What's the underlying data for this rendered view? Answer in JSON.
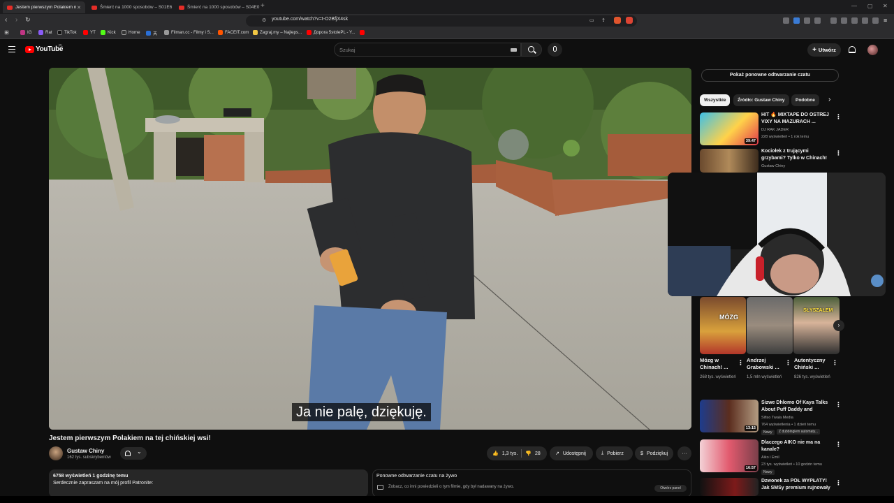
{
  "browser": {
    "tabs": [
      {
        "label": "Jestem pierwszym Polakiem n"
      },
      {
        "label": "Śmierć na 1000 sposobów – S01E6"
      },
      {
        "label": "Śmierć na 1000 sposobów – S04E0"
      }
    ],
    "new_tab": "+",
    "url": "youtube.com/watch?v=t-O2BfjX4sk",
    "bookmarks": [
      "IG",
      "Rat",
      "TikTok",
      "YT",
      "Kick",
      "Home",
      "天",
      "Filman.cc - Filmy i S...",
      "FACEIT.com",
      "Zagraj.my – Najleps...",
      "Доpora 5stolePL - Y..."
    ]
  },
  "header": {
    "logo": "YouTube",
    "region": "PL",
    "search_placeholder": "Szukaj",
    "create_label": "Utwórz"
  },
  "video": {
    "subtitle": "Ja nie palę, dziękuję.",
    "title": "Jestem pierwszym Polakiem na tej chińskiej wsi!",
    "channel": "Gustaw Chiny",
    "subscribers": "162 tys. subskrybentów",
    "likes": "1,3 tys.",
    "dislikes": "28",
    "share": "Udostępnij",
    "download": "Pobierz",
    "thanks": "Podziękuj",
    "desc_meta": "6758 wyświetleń  1 godzinę temu",
    "desc_text": "Serdecznie zapraszam na mój profil Patronite:",
    "chat_title": "Ponowne odtwarzanie czatu na żywo",
    "chat_sub": "Zobacz, co inni powiedzieli o tym filmie, gdy był nadawany na żywo.",
    "chat_button": "Otwórz panel"
  },
  "sidebar": {
    "replay_button": "Pokaż ponowne odtwarzanie czatu",
    "chips": [
      "Wszystkie",
      "Źródło: Gustaw Chiny",
      "Podobne"
    ],
    "recommendations_top": [
      {
        "title": "HIT 🔥 MIXTAPE DO OSTREJ VIXY NA MAZURACH ...",
        "channel": "DJ RAK JADER",
        "meta": "228 wyświetleń • 1 rok temu",
        "duration": "39:47"
      },
      {
        "title": "Kociołek z trującymi grzybami? Tylko w Chinach!",
        "channel": "Gustaw Chiny",
        "meta": ""
      }
    ],
    "shorts": [
      {
        "title": "Mózg w Chinach! ...",
        "views": "268 tys. wyświetleń",
        "overlay": "MÓZG"
      },
      {
        "title": "Andrzej Grabowski ...",
        "views": "1,5 mln wyświetleń",
        "overlay": ""
      },
      {
        "title": "Autentyczny Chiński ...",
        "views": "826 tys. wyświetleń",
        "overlay": "SŁYSZAŁEM"
      }
    ],
    "recommendations_bottom": [
      {
        "title": "Sizwe Dhlomo Of Kaya Talks About Puff Daddy and Preside...",
        "channel": "Sifiso Twala Media",
        "meta": "764 wyświetlenia • 1 dzień temu",
        "badge1": "Nowy",
        "badge2": "Z dubbingiem automaty...",
        "duration": "13:15"
      },
      {
        "title": "Dlaczego AIKO nie ma na kanale?",
        "channel": "Aiko i Emil",
        "meta": "23 tys. wyświetleń • 10 godzin temu",
        "badge1": "Nowy",
        "duration": "16:57"
      },
      {
        "title": "Dzwonek za PÓŁ WYPŁATY! Jak SMSy premium rujnowały",
        "channel": "",
        "meta": ""
      }
    ]
  }
}
